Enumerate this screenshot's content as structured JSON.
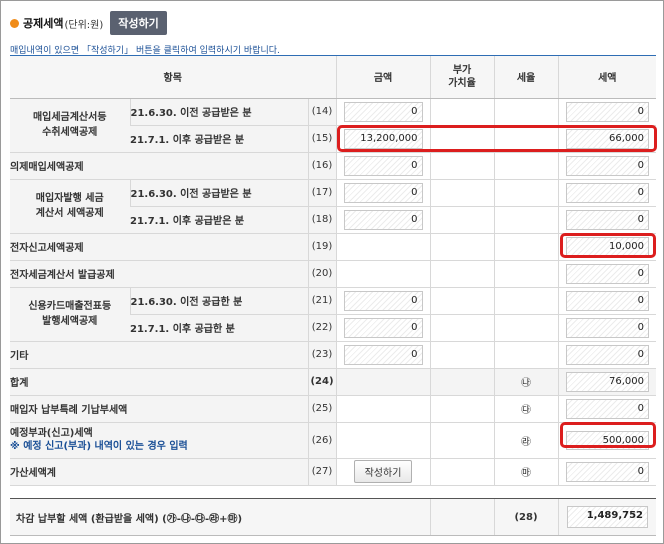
{
  "header": {
    "title": "공제세액",
    "unit": "(단위:원)",
    "write_button": "작성하기"
  },
  "notice": "매입내역이 있으면 「작성하기」 버튼을 클릭하여 입력하시기 바랍니다.",
  "columns": {
    "item": "항목",
    "amount": "금액",
    "vat_rate": "부가\n가치율",
    "tax_rate": "세율",
    "tax": "세액"
  },
  "rows": {
    "r14": {
      "group": "매입세금계산서등\n수취세액공제",
      "label": "21.6.30. 이전 공급받은 분",
      "num": "(14)",
      "amount": "0",
      "tax": "0"
    },
    "r15": {
      "label": "21.7.1. 이후 공급받은 분",
      "num": "(15)",
      "amount": "13,200,000",
      "tax": "66,000"
    },
    "r16": {
      "label": "의제매입세액공제",
      "num": "(16)",
      "amount": "0",
      "tax": "0"
    },
    "r17": {
      "group": "매입자발행 세금\n계산서 세액공제",
      "label": "21.6.30. 이전 공급받은 분",
      "num": "(17)",
      "amount": "0",
      "tax": "0"
    },
    "r18": {
      "label": "21.7.1. 이후 공급받은 분",
      "num": "(18)",
      "amount": "0",
      "tax": "0"
    },
    "r19": {
      "label": "전자신고세액공제",
      "num": "(19)",
      "tax": "10,000"
    },
    "r20": {
      "label": "전자세금계산서 발급공제",
      "num": "(20)",
      "tax": "0"
    },
    "r21": {
      "group": "신용카드매출전표등\n발행세액공제",
      "label": "21.6.30. 이전 공급한 분",
      "num": "(21)",
      "amount": "0",
      "tax": "0"
    },
    "r22": {
      "label": "21.7.1. 이후 공급한 분",
      "num": "(22)",
      "amount": "0",
      "tax": "0"
    },
    "r23": {
      "label": "기타",
      "num": "(23)",
      "amount": "0",
      "tax": "0"
    },
    "r24": {
      "label": "합계",
      "num": "(24)",
      "symbol": "㉯",
      "tax": "76,000"
    },
    "r25": {
      "label": "매입자 납부특례 기납부세액",
      "num": "(25)",
      "symbol": "㉰",
      "tax": "0"
    },
    "r26": {
      "label": "예정부과(신고)세액",
      "note": "※ 예정 신고(부과) 내역이 있는 경우 입력",
      "num": "(26)",
      "symbol": "㉱",
      "tax": "500,000"
    },
    "r27": {
      "label": "가산세액계",
      "num": "(27)",
      "button": "작성하기",
      "symbol": "㉲",
      "tax": "0"
    }
  },
  "total": {
    "label": "차감 납부할 세액 (환급받을 세액) (㉮-㉯-㉰-㉱+㉲)",
    "num": "(28)",
    "tax": "1,489,752"
  },
  "highlight_color": "#dc1e1e"
}
